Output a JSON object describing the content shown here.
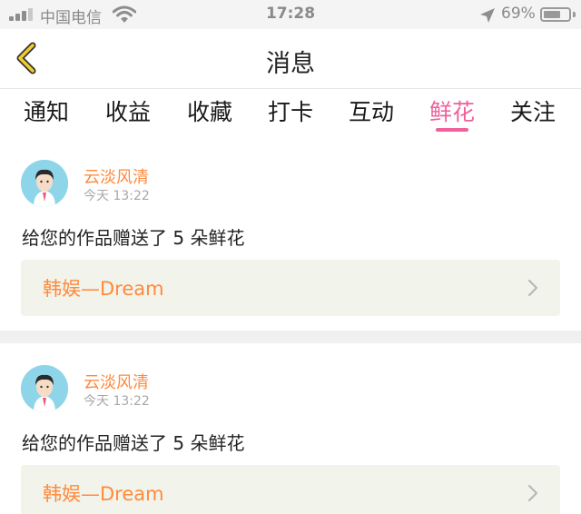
{
  "status_bar": {
    "carrier": "中国电信",
    "time": "17:28",
    "battery_percent": "69%",
    "battery_level": 0.69,
    "icons": [
      "signal-icon",
      "wifi-icon",
      "location-arrow-icon",
      "battery-icon"
    ]
  },
  "nav": {
    "title": "消息",
    "back_icon": "chevron-left-icon",
    "back_color": "#f2cb2d"
  },
  "tabs": {
    "items": [
      "通知",
      "收益",
      "收藏",
      "打卡",
      "互动",
      "鲜花",
      "关注"
    ],
    "active_index": 5,
    "active_color": "#f0609b"
  },
  "messages": [
    {
      "user": "云淡风清",
      "time": "今天 13:22",
      "text": "给您的作品赠送了 5 朵鲜花",
      "work_title": "韩娱—Dream",
      "chevron_icon": "chevron-right-icon"
    },
    {
      "user": "云淡风清",
      "time": "今天 13:22",
      "text": "给您的作品赠送了 5 朵鲜花",
      "work_title": "韩娱—Dream",
      "chevron_icon": "chevron-right-icon"
    }
  ],
  "colors": {
    "accent_orange": "#ff8a3d",
    "card_box_bg": "#f2f3ea",
    "avatar_bg": "#8fd5ea"
  }
}
